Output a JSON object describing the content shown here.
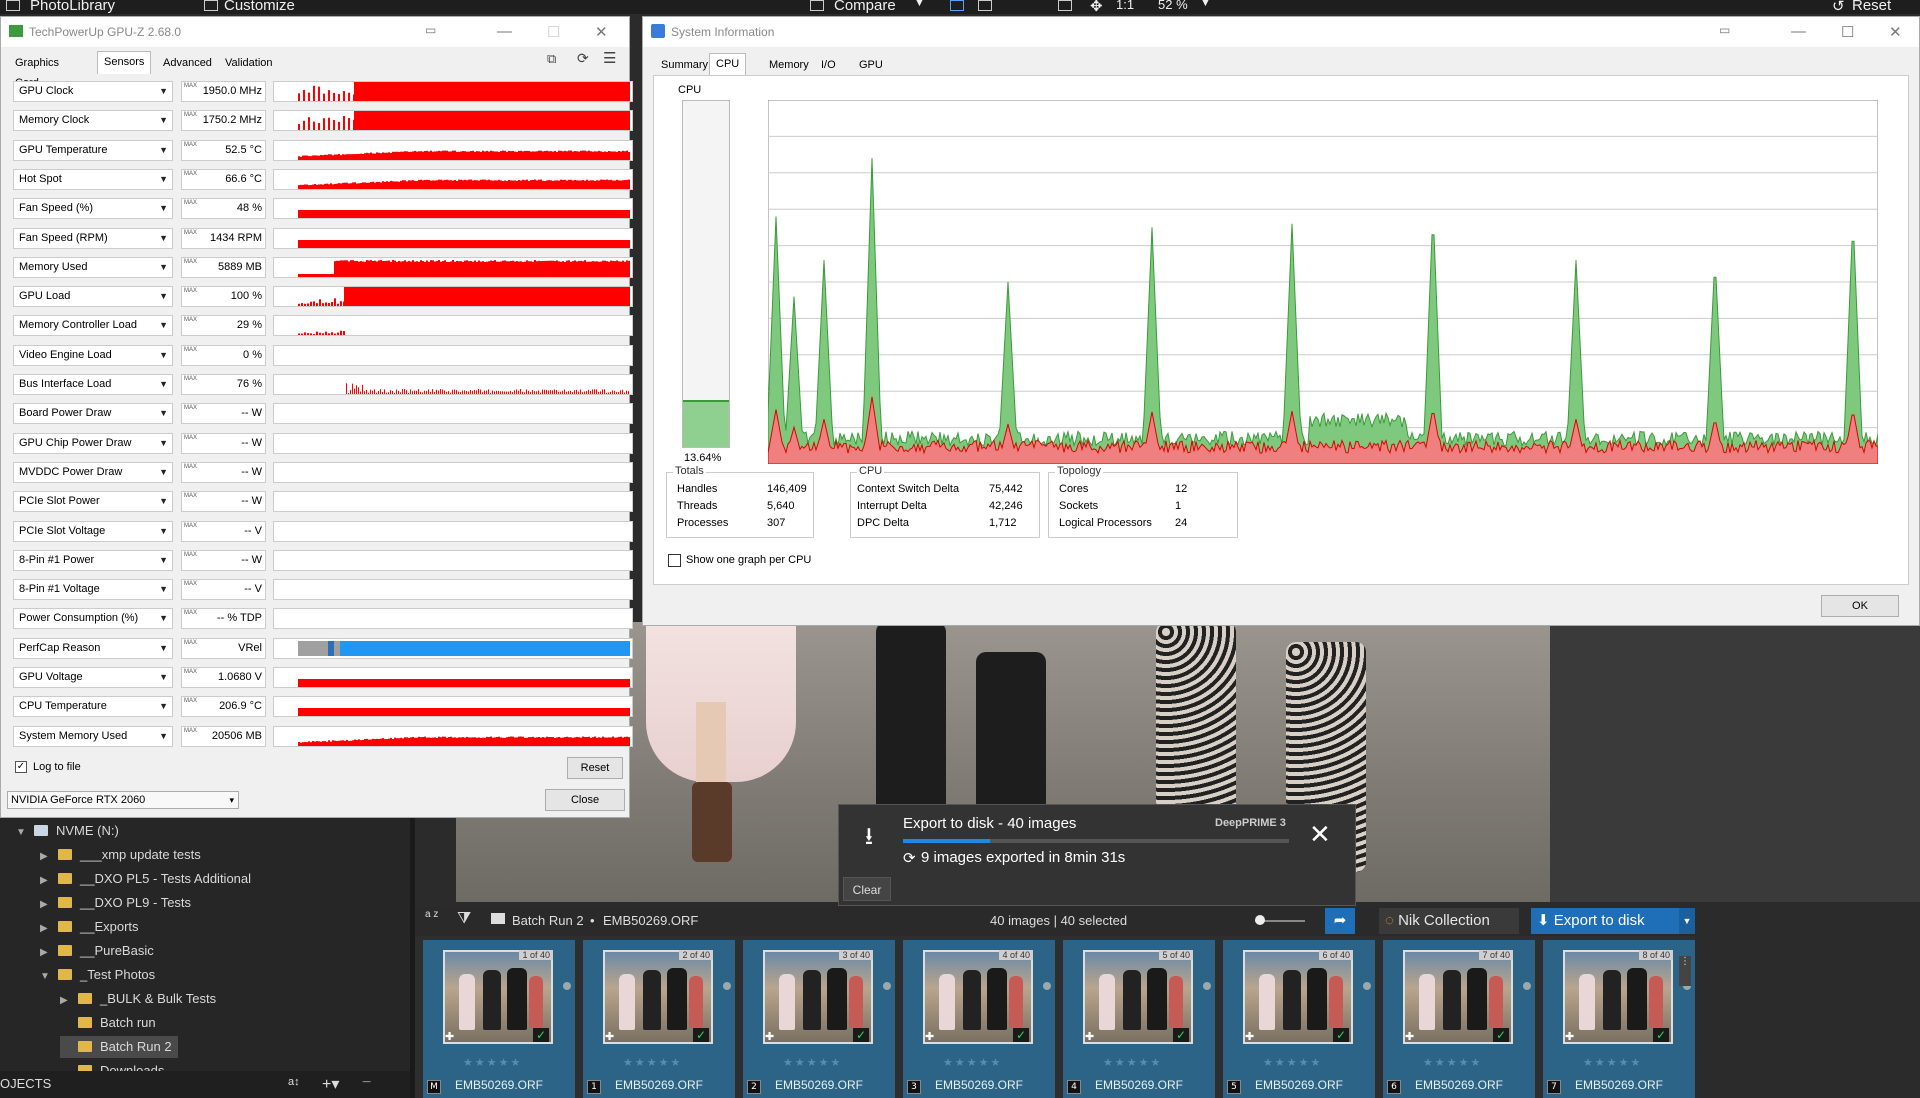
{
  "app": {
    "top_labels": [
      "PhotoLibrary",
      "Customize",
      "Compare",
      "1:1",
      "52 %",
      "Reset"
    ]
  },
  "tree": {
    "items": [
      {
        "label": "NVME (N:)",
        "depth": 0,
        "expanded": true
      },
      {
        "label": "___xmp update tests",
        "depth": 1
      },
      {
        "label": "__DXO PL5 - Tests Additional",
        "depth": 1
      },
      {
        "label": "__DXO PL9 - Tests",
        "depth": 1
      },
      {
        "label": "__Exports",
        "depth": 1
      },
      {
        "label": "__PureBasic",
        "depth": 1
      },
      {
        "label": "_Test Photos",
        "depth": 1,
        "expanded": true
      },
      {
        "label": "_BULK & Bulk Tests",
        "depth": 2
      },
      {
        "label": "Batch run",
        "depth": 2
      },
      {
        "label": "Batch Run 2",
        "depth": 2,
        "selected": true
      },
      {
        "label": "Downloads",
        "depth": 2
      }
    ],
    "footer_label": "OJECTS"
  },
  "filmstrip": {
    "sort_label": "a z",
    "breadcrumb_folder": "Batch Run 2",
    "breadcrumb_file": "EMB50269.ORF",
    "count_label": "40 images | 40 selected",
    "nik_label": "Nik Collection",
    "export_label": "Export to disk",
    "thumbs": [
      {
        "ofn": "1 of 40",
        "name": "EMB50269.ORF",
        "idx": "M"
      },
      {
        "ofn": "2 of 40",
        "name": "EMB50269.ORF",
        "idx": "1"
      },
      {
        "ofn": "3 of 40",
        "name": "EMB50269.ORF",
        "idx": "2"
      },
      {
        "ofn": "4 of 40",
        "name": "EMB50269.ORF",
        "idx": "3"
      },
      {
        "ofn": "5 of 40",
        "name": "EMB50269.ORF",
        "idx": "4"
      },
      {
        "ofn": "6 of 40",
        "name": "EMB50269.ORF",
        "idx": "5"
      },
      {
        "ofn": "7 of 40",
        "name": "EMB50269.ORF",
        "idx": "6"
      },
      {
        "ofn": "8 of 40",
        "name": "EMB50269.ORF",
        "idx": "7"
      }
    ]
  },
  "toast": {
    "title": "Export to disk - 40 images",
    "engine": "DeepPRIME 3",
    "status": "9 images exported in 8min 31s",
    "progress": 0.225,
    "clear_label": "Clear"
  },
  "gpuz": {
    "title": "TechPowerUp GPU-Z 2.68.0",
    "tabs": [
      "Graphics Card",
      "Sensors",
      "Advanced",
      "Validation"
    ],
    "active_tab": "Sensors",
    "max_label": "MAX",
    "sensors": [
      {
        "name": "GPU Clock",
        "value": "1950.0 MHz",
        "kind": "spiky"
      },
      {
        "name": "Memory Clock",
        "value": "1750.2 MHz",
        "kind": "spiky"
      },
      {
        "name": "GPU Temperature",
        "value": "52.5 °C",
        "kind": "ramp"
      },
      {
        "name": "Hot Spot",
        "value": "66.6 °C",
        "kind": "ramp"
      },
      {
        "name": "Fan Speed (%)",
        "value": "48 %",
        "kind": "flat"
      },
      {
        "name": "Fan Speed (RPM)",
        "value": "1434 RPM",
        "kind": "flat"
      },
      {
        "name": "Memory Used",
        "value": "5889 MB",
        "kind": "step"
      },
      {
        "name": "GPU Load",
        "value": "100 %",
        "kind": "full"
      },
      {
        "name": "Memory Controller Load",
        "value": "29 %",
        "kind": "tiny"
      },
      {
        "name": "Video Engine Load",
        "value": "0 %",
        "kind": "none"
      },
      {
        "name": "Bus Interface Load",
        "value": "76 %",
        "kind": "line"
      },
      {
        "name": "Board Power Draw",
        "value": "-- W",
        "kind": "none"
      },
      {
        "name": "GPU Chip Power Draw",
        "value": "-- W",
        "kind": "none"
      },
      {
        "name": "MVDDC Power Draw",
        "value": "-- W",
        "kind": "none"
      },
      {
        "name": "PCIe Slot Power",
        "value": "-- W",
        "kind": "none"
      },
      {
        "name": "PCIe Slot Voltage",
        "value": "-- V",
        "kind": "none"
      },
      {
        "name": "8-Pin #1 Power",
        "value": "-- W",
        "kind": "none"
      },
      {
        "name": "8-Pin #1 Voltage",
        "value": "-- V",
        "kind": "none"
      },
      {
        "name": "Power Consumption (%)",
        "value": "-- % TDP",
        "kind": "none"
      },
      {
        "name": "PerfCap Reason",
        "value": "VRel",
        "kind": "perfcap"
      },
      {
        "name": "GPU Voltage",
        "value": "1.0680 V",
        "kind": "flat"
      },
      {
        "name": "CPU Temperature",
        "value": "206.9 °C",
        "kind": "flat"
      },
      {
        "name": "System Memory Used",
        "value": "20506 MB",
        "kind": "ramp"
      }
    ],
    "log_label": "Log to file",
    "log_checked": true,
    "reset_label": "Reset",
    "device": "NVIDIA GeForce RTX 2060",
    "close_label": "Close"
  },
  "sysinfo": {
    "title": "System Information",
    "tabs": [
      "Summary",
      "CPU",
      "Memory",
      "I/O",
      "GPU"
    ],
    "active_tab": "CPU",
    "cpu_label": "CPU",
    "cpu_percent": "13.64%",
    "cpu_fill": 0.1364,
    "totals": {
      "label": "Totals",
      "rows": [
        {
          "k": "Handles",
          "v": "146,409"
        },
        {
          "k": "Threads",
          "v": "5,640"
        },
        {
          "k": "Processes",
          "v": "307"
        }
      ]
    },
    "cpu_group": {
      "label": "CPU",
      "rows": [
        {
          "k": "Context Switch Delta",
          "v": "75,442"
        },
        {
          "k": "Interrupt Delta",
          "v": "42,246"
        },
        {
          "k": "DPC Delta",
          "v": "1,712"
        }
      ]
    },
    "topology": {
      "label": "Topology",
      "rows": [
        {
          "k": "Cores",
          "v": "12"
        },
        {
          "k": "Sockets",
          "v": "1"
        },
        {
          "k": "Logical Processors",
          "v": "24"
        }
      ]
    },
    "one_graph_label": "Show one graph per CPU",
    "ok_label": "OK",
    "colors": {
      "kernel": "#f08080",
      "total": "#3a9a3a",
      "kernel_line": "#e00000"
    }
  }
}
